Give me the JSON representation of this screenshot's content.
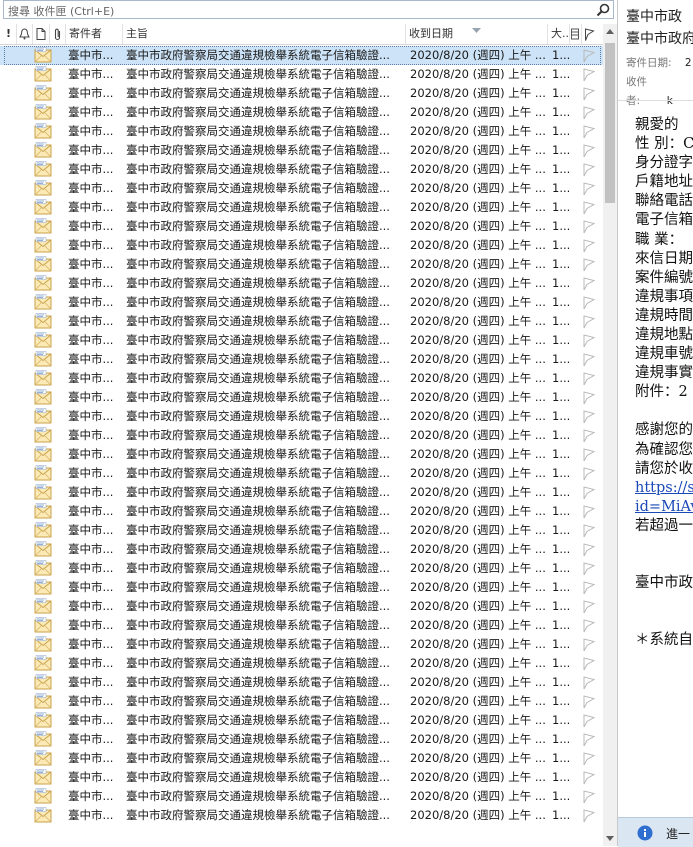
{
  "search": {
    "placeholder": "搜尋 收件匣 (Ctrl+E)"
  },
  "columns": {
    "importance": "!",
    "from": "寄件者",
    "subject": "主旨",
    "received": "收到日期",
    "size": "大..."
  },
  "message_row": {
    "from": "臺中市...",
    "subject": "臺中市政府警察局交通違規檢舉系統電子信箱驗證...",
    "received": "2020/8/20 (週四) 上午 ...",
    "size": "1..."
  },
  "message_count": 41,
  "selected_index": 0,
  "reading": {
    "subject_line1": "臺中市政",
    "subject_line2": "臺中市政府",
    "meta_date_label": "寄件日期:",
    "meta_date_value": "2",
    "meta_to_label": "收件者:",
    "meta_to_value": "k",
    "body": [
      "親愛的",
      "性 別：C",
      "身分證字",
      "戶籍地址",
      "聯絡電話",
      "電子信箱",
      "職 業：",
      "來信日期",
      "案件編號",
      "違規事項",
      "違規時間",
      "違規地點",
      "違規車號",
      "違規事實",
      "附件：2",
      "",
      "感謝您的",
      "為確認您",
      "請您於收",
      "https://su",
      "id=MiAv",
      "若超過一",
      "",
      "",
      "臺中市政",
      "",
      "",
      "＊系統自"
    ],
    "infobar_text": "進一"
  },
  "colors": {
    "selected_row": "#cde3f7",
    "link": "#1a49b8",
    "infobar": "#dbe6f3"
  }
}
